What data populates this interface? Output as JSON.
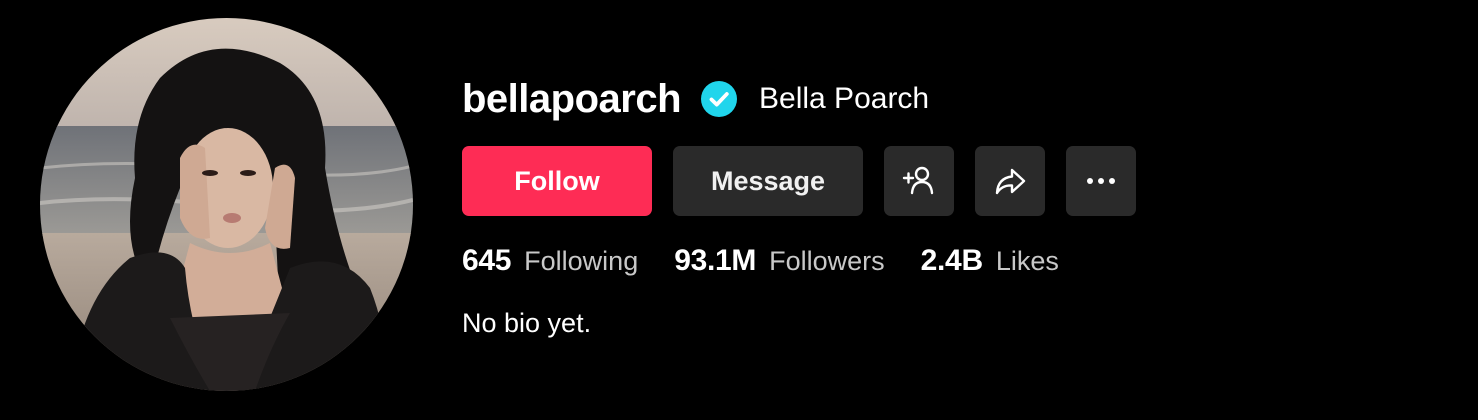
{
  "profile": {
    "username": "bellapoarch",
    "display_name": "Bella Poarch",
    "verified": true,
    "verified_badge_color": "#20d5ec",
    "avatar_icon": "profile-photo",
    "bio": "No bio yet."
  },
  "actions": {
    "follow_label": "Follow",
    "follow_color": "#fe2c55",
    "message_label": "Message",
    "add_friend_icon": "add-user-icon",
    "share_icon": "share-icon",
    "more_icon": "more-icon"
  },
  "stats": [
    {
      "value": "645",
      "label": "Following"
    },
    {
      "value": "93.1M",
      "label": "Followers"
    },
    {
      "value": "2.4B",
      "label": "Likes"
    }
  ]
}
